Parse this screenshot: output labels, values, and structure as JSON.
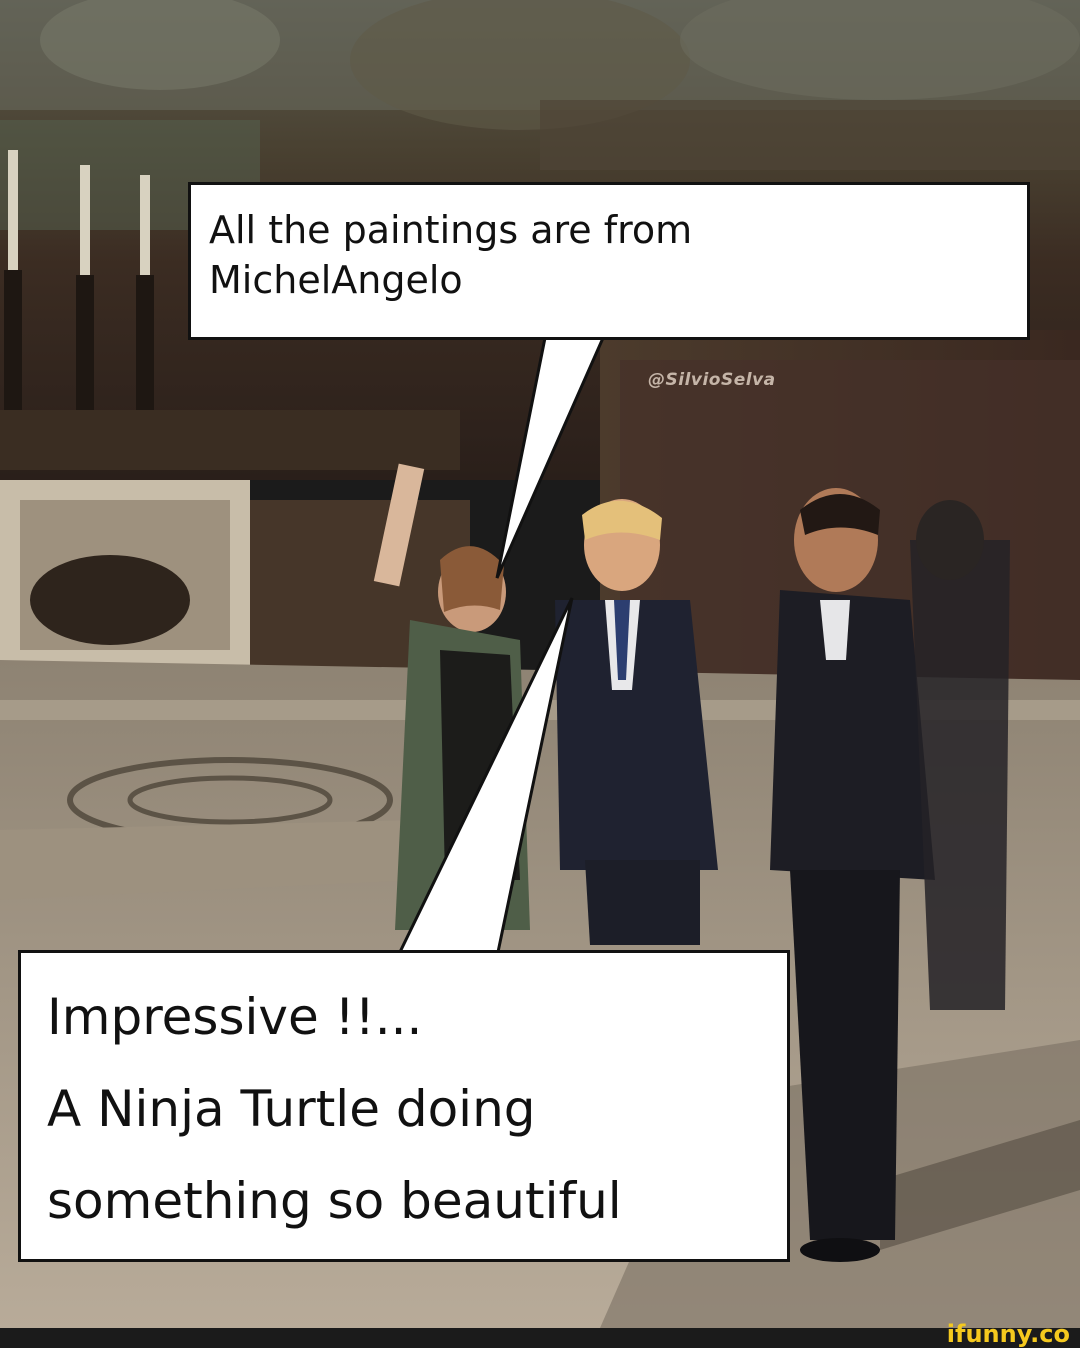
{
  "bubbles": {
    "top": {
      "lines": [
        "All the paintings are from",
        "MichelAngelo"
      ]
    },
    "bottom": {
      "lines": [
        "Impressive !!...",
        "A Ninja Turtle doing",
        "something so beautiful"
      ]
    }
  },
  "watermark": "@SilvioSelva",
  "footer": {
    "brand": "ifunny.co"
  },
  "colors": {
    "bubble_fill": "#ffffff",
    "bubble_border": "#111111",
    "brand": "#f5c91e"
  }
}
